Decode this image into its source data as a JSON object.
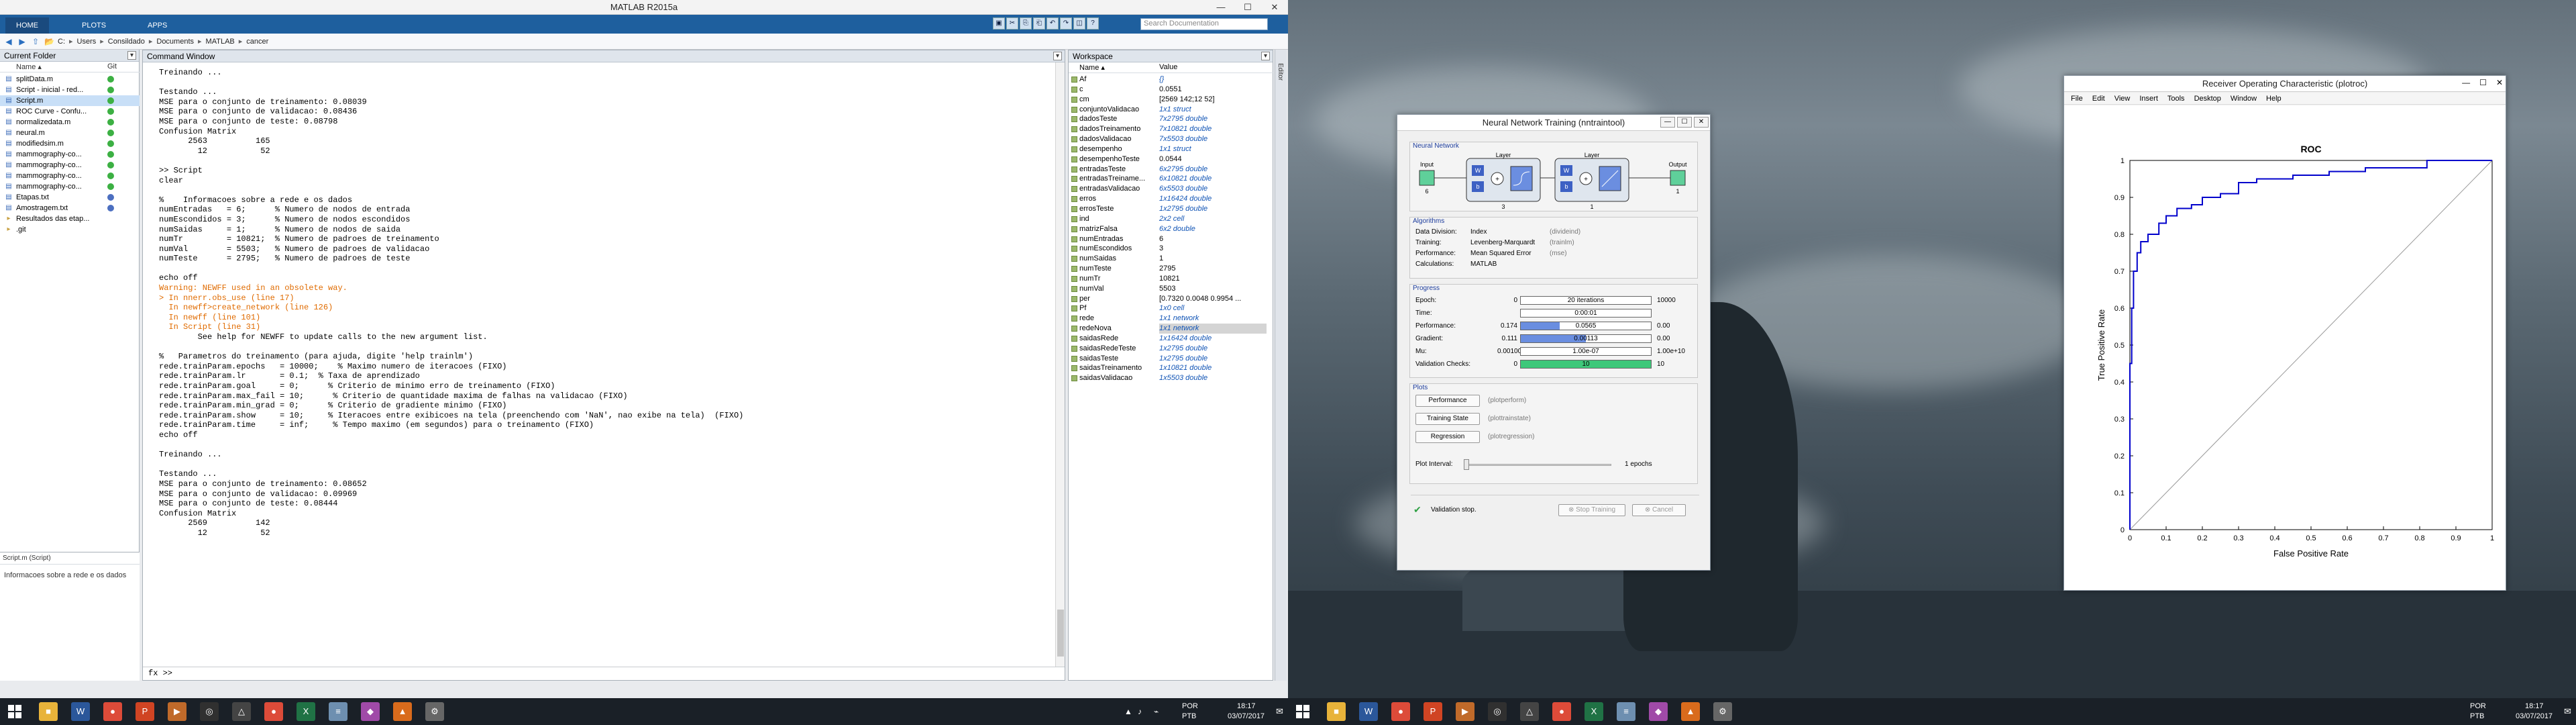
{
  "matlab": {
    "title": "MATLAB R2015a",
    "tabs": [
      "HOME",
      "PLOTS",
      "APPS"
    ],
    "search_placeholder": "Search Documentation",
    "path": [
      "C:",
      "Users",
      "Consildado",
      "Documents",
      "MATLAB",
      "cancer"
    ],
    "current_folder": {
      "title": "Current Folder",
      "col_name": "Name ▴",
      "col_git": "Git",
      "files": [
        {
          "name": "splitData.m",
          "selected": false
        },
        {
          "name": "Script - inicial - red...",
          "selected": false
        },
        {
          "name": "Script.m",
          "selected": true
        },
        {
          "name": "ROC Curve - Confu...",
          "selected": false
        },
        {
          "name": "normalizedata.m",
          "selected": false
        },
        {
          "name": "neural.m",
          "selected": false
        },
        {
          "name": "modifiedsim.m",
          "selected": false
        },
        {
          "name": "mammography-co...",
          "selected": false
        },
        {
          "name": "mammography-co...",
          "selected": false
        },
        {
          "name": "mammography-co...",
          "selected": false
        },
        {
          "name": "mammography-co...",
          "selected": false
        },
        {
          "name": "Etapas.txt",
          "selected": false
        },
        {
          "name": "Amostragem.txt",
          "selected": false
        },
        {
          "name": "Resultados das etap...",
          "selected": false
        },
        {
          "name": ".git",
          "selected": false
        }
      ],
      "detail_file": "Script.m (Script)",
      "detail_desc": "Informacoes sobre a rede e os dados"
    },
    "command_window": {
      "title": "Command Window",
      "lines": [
        {
          "t": "Treinando ...",
          "c": ""
        },
        {
          "t": "",
          "c": ""
        },
        {
          "t": "Testando ...",
          "c": ""
        },
        {
          "t": "MSE para o conjunto de treinamento: 0.08039",
          "c": ""
        },
        {
          "t": "MSE para o conjunto de validacao: 0.08436",
          "c": ""
        },
        {
          "t": "MSE para o conjunto de teste: 0.08798",
          "c": ""
        },
        {
          "t": "Confusion Matrix",
          "c": ""
        },
        {
          "t": "      2563          165",
          "c": ""
        },
        {
          "t": "        12           52",
          "c": ""
        },
        {
          "t": "",
          "c": ""
        },
        {
          "t": ">> Script",
          "c": ""
        },
        {
          "t": "clear",
          "c": ""
        },
        {
          "t": "",
          "c": ""
        },
        {
          "t": "%    Informacoes sobre a rede e os dados",
          "c": ""
        },
        {
          "t": "numEntradas   = 6;      % Numero de nodos de entrada",
          "c": ""
        },
        {
          "t": "numEscondidos = 3;      % Numero de nodos escondidos",
          "c": ""
        },
        {
          "t": "numSaidas     = 1;      % Numero de nodos de saida",
          "c": ""
        },
        {
          "t": "numTr         = 10821;  % Numero de padroes de treinamento",
          "c": ""
        },
        {
          "t": "numVal        = 5503;   % Numero de padroes de validacao",
          "c": ""
        },
        {
          "t": "numTeste      = 2795;   % Numero de padroes de teste",
          "c": ""
        },
        {
          "t": "",
          "c": ""
        },
        {
          "t": "echo off",
          "c": ""
        },
        {
          "t": "Warning: NEWFF used in an obsolete way.",
          "c": "warn"
        },
        {
          "t": "> In nnerr.obs_use (line 17)",
          "c": "warn"
        },
        {
          "t": "  In newff>create_network (line 126)",
          "c": "warn"
        },
        {
          "t": "  In newff (line 101)",
          "c": "warn"
        },
        {
          "t": "  In Script (line 31)",
          "c": "warn"
        },
        {
          "t": "        See help for NEWFF to update calls to the new argument list.",
          "c": ""
        },
        {
          "t": "",
          "c": ""
        },
        {
          "t": "%   Parametros do treinamento (para ajuda, digite 'help trainlm')",
          "c": ""
        },
        {
          "t": "rede.trainParam.epochs   = 10000;    % Maximo numero de iteracoes (FIXO)",
          "c": ""
        },
        {
          "t": "rede.trainParam.lr       = 0.1;  % Taxa de aprendizado",
          "c": ""
        },
        {
          "t": "rede.trainParam.goal     = 0;      % Criterio de minimo erro de treinamento (FIXO)",
          "c": ""
        },
        {
          "t": "rede.trainParam.max_fail = 10;      % Criterio de quantidade maxima de falhas na validacao (FIXO)",
          "c": ""
        },
        {
          "t": "rede.trainParam.min_grad = 0;      % Criterio de gradiente minimo (FIXO)",
          "c": ""
        },
        {
          "t": "rede.trainParam.show     = 10;     % Iteracoes entre exibicoes na tela (preenchendo com 'NaN', nao exibe na tela)  (FIXO)",
          "c": ""
        },
        {
          "t": "rede.trainParam.time     = inf;     % Tempo maximo (em segundos) para o treinamento (FIXO)",
          "c": ""
        },
        {
          "t": "echo off",
          "c": ""
        },
        {
          "t": "",
          "c": ""
        },
        {
          "t": "Treinando ...",
          "c": ""
        },
        {
          "t": "",
          "c": ""
        },
        {
          "t": "Testando ...",
          "c": ""
        },
        {
          "t": "MSE para o conjunto de treinamento: 0.08652",
          "c": ""
        },
        {
          "t": "MSE para o conjunto de validacao: 0.09969",
          "c": ""
        },
        {
          "t": "MSE para o conjunto de teste: 0.08444",
          "c": ""
        },
        {
          "t": "Confusion Matrix",
          "c": ""
        },
        {
          "t": "      2569          142",
          "c": ""
        },
        {
          "t": "        12           52",
          "c": ""
        }
      ],
      "prompt": "fx >>"
    },
    "workspace": {
      "title": "Workspace",
      "col_name": "Name ▴",
      "col_value": "Value",
      "vars": [
        {
          "name": "Af",
          "value": "{}",
          "blue": true
        },
        {
          "name": "c",
          "value": "0.0551",
          "blue": false
        },
        {
          "name": "cm",
          "value": "[2569 142;12 52]",
          "blue": false
        },
        {
          "name": "conjuntoValidacao",
          "value": "1x1 struct",
          "blue": true
        },
        {
          "name": "dadosTeste",
          "value": "7x2795 double",
          "blue": true
        },
        {
          "name": "dadosTreinamento",
          "value": "7x10821 double",
          "blue": true
        },
        {
          "name": "dadosValidacao",
          "value": "7x5503 double",
          "blue": true
        },
        {
          "name": "desempenho",
          "value": "1x1 struct",
          "blue": true
        },
        {
          "name": "desempenhoTeste",
          "value": "0.0544",
          "blue": false
        },
        {
          "name": "entradasTeste",
          "value": "6x2795 double",
          "blue": true
        },
        {
          "name": "entradasTreiname...",
          "value": "6x10821 double",
          "blue": true
        },
        {
          "name": "entradasValidacao",
          "value": "6x5503 double",
          "blue": true
        },
        {
          "name": "erros",
          "value": "1x16424 double",
          "blue": true
        },
        {
          "name": "errosTeste",
          "value": "1x2795 double",
          "blue": true
        },
        {
          "name": "ind",
          "value": "2x2 cell",
          "blue": true
        },
        {
          "name": "matrizFalsa",
          "value": "6x2 double",
          "blue": true
        },
        {
          "name": "numEntradas",
          "value": "6",
          "blue": false
        },
        {
          "name": "numEscondidos",
          "value": "3",
          "blue": false
        },
        {
          "name": "numSaidas",
          "value": "1",
          "blue": false
        },
        {
          "name": "numTeste",
          "value": "2795",
          "blue": false
        },
        {
          "name": "numTr",
          "value": "10821",
          "blue": false
        },
        {
          "name": "numVal",
          "value": "5503",
          "blue": false
        },
        {
          "name": "per",
          "value": "[0.7320 0.0048 0.9954 ...",
          "blue": false
        },
        {
          "name": "Pf",
          "value": "1x0 cell",
          "blue": true
        },
        {
          "name": "rede",
          "value": "1x1 network",
          "blue": true
        },
        {
          "name": "redeNova",
          "value": "1x1 network",
          "blue": true,
          "selected": true
        },
        {
          "name": "saidasRede",
          "value": "1x16424 double",
          "blue": true
        },
        {
          "name": "saidasRedeTeste",
          "value": "1x2795 double",
          "blue": true
        },
        {
          "name": "saidasTeste",
          "value": "1x2795 double",
          "blue": true
        },
        {
          "name": "saidasTreinamento",
          "value": "1x10821 double",
          "blue": true
        },
        {
          "name": "saidasValidacao",
          "value": "1x5503 double",
          "blue": true
        }
      ]
    },
    "editor_label": "Editor"
  },
  "nntraining": {
    "title": "Neural Network Training (nntraintool)",
    "sections": {
      "network": "Neural Network",
      "algorithms": "Algorithms",
      "progress": "Progress",
      "plots": "Plots"
    },
    "network": {
      "input": "Input",
      "input_n": "6",
      "layer1": "Layer",
      "layer1_n": "3",
      "layer2": "Layer",
      "layer2_n": "1",
      "output": "Output",
      "output_n": "1",
      "w": "W",
      "b": "b"
    },
    "algorithms": [
      {
        "label": "Data Division:",
        "value": "Index",
        "note": "(divideind)"
      },
      {
        "label": "Training:",
        "value": "Levenberg-Marquardt",
        "note": "(trainlm)"
      },
      {
        "label": "Performance:",
        "value": "Mean Squared Error",
        "note": "(mse)"
      },
      {
        "label": "Calculations:",
        "value": "MATLAB",
        "note": ""
      }
    ],
    "progress": [
      {
        "label": "Epoch:",
        "start": "0",
        "bar": "20 iterations",
        "end": "10000",
        "fill": 0.0,
        "color": "#5aa0e0"
      },
      {
        "label": "Time:",
        "start": "",
        "bar": "0:00:01",
        "end": "",
        "fill": 0.0,
        "color": "#5aa0e0"
      },
      {
        "label": "Performance:",
        "start": "0.174",
        "bar": "0.0565",
        "end": "0.00",
        "fill": 0.3,
        "color": "#6a8ee0"
      },
      {
        "label": "Gradient:",
        "start": "0.111",
        "bar": "0.00113",
        "end": "0.00",
        "fill": 0.5,
        "color": "#6a8ee0"
      },
      {
        "label": "Mu:",
        "start": "0.00100",
        "bar": "1.00e-07",
        "end": "1.00e+10",
        "fill": 0.0,
        "color": "#6a8ee0"
      },
      {
        "label": "Validation Checks:",
        "start": "0",
        "bar": "10",
        "end": "10",
        "fill": 1.0,
        "color": "#3ec87a"
      }
    ],
    "plots": [
      {
        "label": "Performance",
        "note": "(plotperform)"
      },
      {
        "label": "Training State",
        "note": "(plottrainstate)"
      },
      {
        "label": "Regression",
        "note": "(plotregression)"
      }
    ],
    "plot_interval_label": "Plot Interval:",
    "plot_interval_value": "1 epochs",
    "status": "Validation stop.",
    "stop_button": "Stop Training",
    "cancel_button": "Cancel"
  },
  "roc": {
    "title": "Receiver Operating Characteristic (plotroc)",
    "menu": [
      "File",
      "Edit",
      "View",
      "Insert",
      "Tools",
      "Desktop",
      "Window",
      "Help"
    ]
  },
  "chart_data": {
    "type": "line",
    "title": "ROC",
    "xlabel": "False Positive Rate",
    "ylabel": "True Positive Rate",
    "xlim": [
      0,
      1
    ],
    "ylim": [
      0,
      1
    ],
    "xticks": [
      "0",
      "0.1",
      "0.2",
      "0.3",
      "0.4",
      "0.5",
      "0.6",
      "0.7",
      "0.8",
      "0.9",
      "1"
    ],
    "yticks": [
      "0",
      "0.1",
      "0.2",
      "0.3",
      "0.4",
      "0.5",
      "0.6",
      "0.7",
      "0.8",
      "0.9",
      "1"
    ],
    "grid": false,
    "series": [
      {
        "name": "",
        "color": "#0000cc",
        "x": [
          0,
          0,
          0.005,
          0.005,
          0.01,
          0.01,
          0.02,
          0.02,
          0.03,
          0.03,
          0.05,
          0.05,
          0.08,
          0.08,
          0.1,
          0.1,
          0.13,
          0.13,
          0.17,
          0.17,
          0.2,
          0.2,
          0.25,
          0.25,
          0.3,
          0.3,
          0.35,
          0.35,
          0.45,
          0.45,
          0.55,
          0.55,
          0.65,
          0.65,
          0.82,
          0.82,
          1.0
        ],
        "y": [
          0,
          0.45,
          0.45,
          0.6,
          0.6,
          0.7,
          0.7,
          0.75,
          0.75,
          0.78,
          0.78,
          0.8,
          0.8,
          0.83,
          0.83,
          0.85,
          0.85,
          0.87,
          0.87,
          0.88,
          0.88,
          0.9,
          0.9,
          0.91,
          0.91,
          0.94,
          0.94,
          0.95,
          0.95,
          0.96,
          0.96,
          0.97,
          0.97,
          0.98,
          0.98,
          1.0,
          1.0
        ]
      },
      {
        "name": "",
        "color": "#999999",
        "x": [
          0,
          1
        ],
        "y": [
          0,
          1
        ]
      }
    ]
  },
  "taskbar": {
    "lang": "POR",
    "lang2": "PTB",
    "time": "18:17",
    "date": "03/07/2017"
  }
}
